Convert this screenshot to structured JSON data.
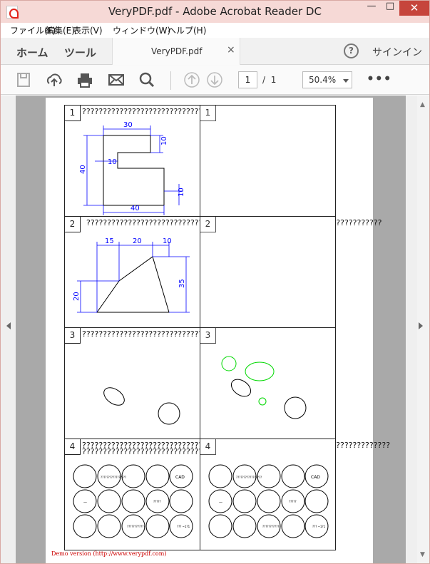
{
  "window": {
    "title": "VeryPDF.pdf - Adobe Acrobat Reader DC",
    "min_label": "—",
    "max_label": "□",
    "close_label": "✕"
  },
  "menu": [
    "ファイル(F)",
    "編集(E)",
    "表示(V)",
    "ウィンドウ(W)",
    "ヘルプ(H)"
  ],
  "tabs": {
    "home": "ホーム",
    "tools": "ツール",
    "document": "VeryPDF.pdf",
    "close": "×",
    "help": "?",
    "signin": "サインイン"
  },
  "toolbar": {
    "page_current": "1",
    "page_separator": "/",
    "page_total": "1",
    "zoom": "50.4%",
    "more": "•••"
  },
  "document": {
    "cells": [
      {
        "num": "1",
        "text": "???????????????????????????????????????????????????????????"
      },
      {
        "num": "1",
        "text": ""
      },
      {
        "num": "2",
        "text": "???????????????????????????????????????????????????????????????????????"
      },
      {
        "num": "2",
        "text": ""
      },
      {
        "num": "3",
        "text": "???????????????????????????????????????????????????????"
      },
      {
        "num": "3",
        "text": ""
      },
      {
        "num": "4",
        "text": "??????????????????????????????????????????????????????????????????????????"
      },
      {
        "num": "4",
        "text": ""
      }
    ],
    "cell4_line2": "?????????????????????????????",
    "dims1": {
      "top": "30",
      "right1": "10",
      "mid": "10",
      "left": "40",
      "right2": "10",
      "bottom": "40"
    },
    "dims2": {
      "a": "15",
      "b": "20",
      "c": "10",
      "left": "20",
      "right": "35"
    },
    "circle_labels": {
      "cad": "CAD",
      "long": "?????????????????",
      "short": "????????????",
      "code": "?????",
      "dash": "—",
      "right": "??? ~1?1"
    },
    "demo": "Demo version (http://www.verypdf.com)"
  },
  "colors": {
    "titlebar": "#f6d9d6",
    "close": "#c6453c",
    "dimension": "#0000ff",
    "highlight": "#00d800"
  }
}
